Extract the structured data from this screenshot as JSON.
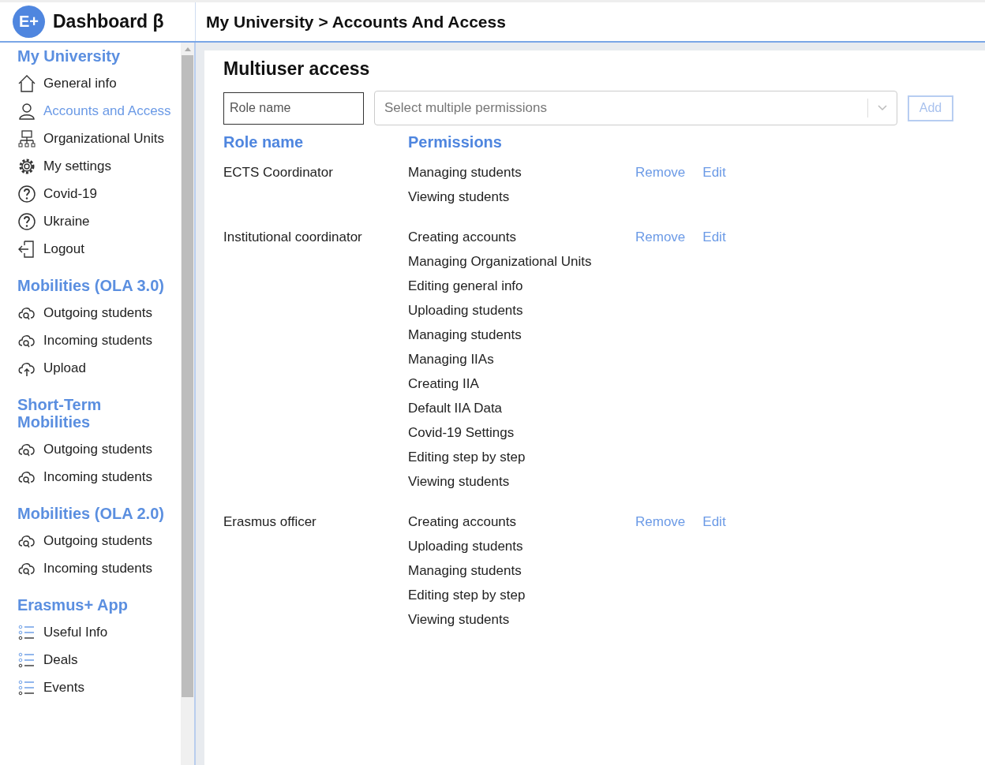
{
  "header": {
    "logo": "E+",
    "title": "Dashboard β",
    "breadcrumb": "My University > Accounts And Access"
  },
  "sidebar": {
    "sections": [
      {
        "title": "My University",
        "items": [
          {
            "label": "General info",
            "kind": "home",
            "selected": false
          },
          {
            "label": "Accounts and Access",
            "kind": "user",
            "selected": true
          },
          {
            "label": "Organizational Units",
            "kind": "org",
            "selected": false
          },
          {
            "label": "My settings",
            "kind": "gear",
            "selected": false
          },
          {
            "label": "Covid-19",
            "kind": "help",
            "selected": false
          },
          {
            "label": "Ukraine",
            "kind": "help",
            "selected": false
          },
          {
            "label": "Logout",
            "kind": "logout",
            "selected": false
          }
        ]
      },
      {
        "title": "Mobilities (OLA 3.0)",
        "items": [
          {
            "label": "Outgoing students",
            "kind": "cloud",
            "selected": false
          },
          {
            "label": "Incoming students",
            "kind": "cloud",
            "selected": false
          },
          {
            "label": "Upload",
            "kind": "upload",
            "selected": false
          }
        ]
      },
      {
        "title": "Short-Term Mobilities",
        "items": [
          {
            "label": "Outgoing students",
            "kind": "cloud",
            "selected": false
          },
          {
            "label": "Incoming students",
            "kind": "cloud",
            "selected": false
          }
        ]
      },
      {
        "title": "Mobilities (OLA 2.0)",
        "items": [
          {
            "label": "Outgoing students",
            "kind": "cloud",
            "selected": false
          },
          {
            "label": "Incoming students",
            "kind": "cloud",
            "selected": false
          }
        ]
      },
      {
        "title": "Erasmus+ App",
        "items": [
          {
            "label": "Useful Info",
            "kind": "list",
            "selected": false
          },
          {
            "label": "Deals",
            "kind": "list",
            "selected": false
          },
          {
            "label": "Events",
            "kind": "list",
            "selected": false
          }
        ]
      }
    ]
  },
  "main": {
    "title": "Multiuser access",
    "role_field": {
      "placeholder": "Role name"
    },
    "permissions_select": {
      "placeholder": "Select multiple permissions"
    },
    "add_button": {
      "label": "Add",
      "disabled": true
    },
    "columns": [
      "Role name",
      "Permissions"
    ],
    "roles": [
      {
        "name": "ECTS Coordinator",
        "permissions": [
          "Managing students",
          "Viewing students"
        ],
        "actions": [
          "Remove",
          "Edit"
        ]
      },
      {
        "name": "Institutional coordinator",
        "permissions": [
          "Creating accounts",
          "Managing Organizational Units",
          "Editing general info",
          "Uploading students",
          "Managing students",
          "Managing IIAs",
          "Creating IIA",
          "Default IIA Data",
          "Covid-19 Settings",
          "Editing step by step",
          "Viewing students"
        ],
        "actions": [
          "Remove",
          "Edit"
        ]
      },
      {
        "name": "Erasmus officer",
        "permissions": [
          "Creating accounts",
          "Uploading students",
          "Managing students",
          "Editing step by step",
          "Viewing students"
        ],
        "actions": [
          "Remove",
          "Edit"
        ]
      }
    ]
  }
}
